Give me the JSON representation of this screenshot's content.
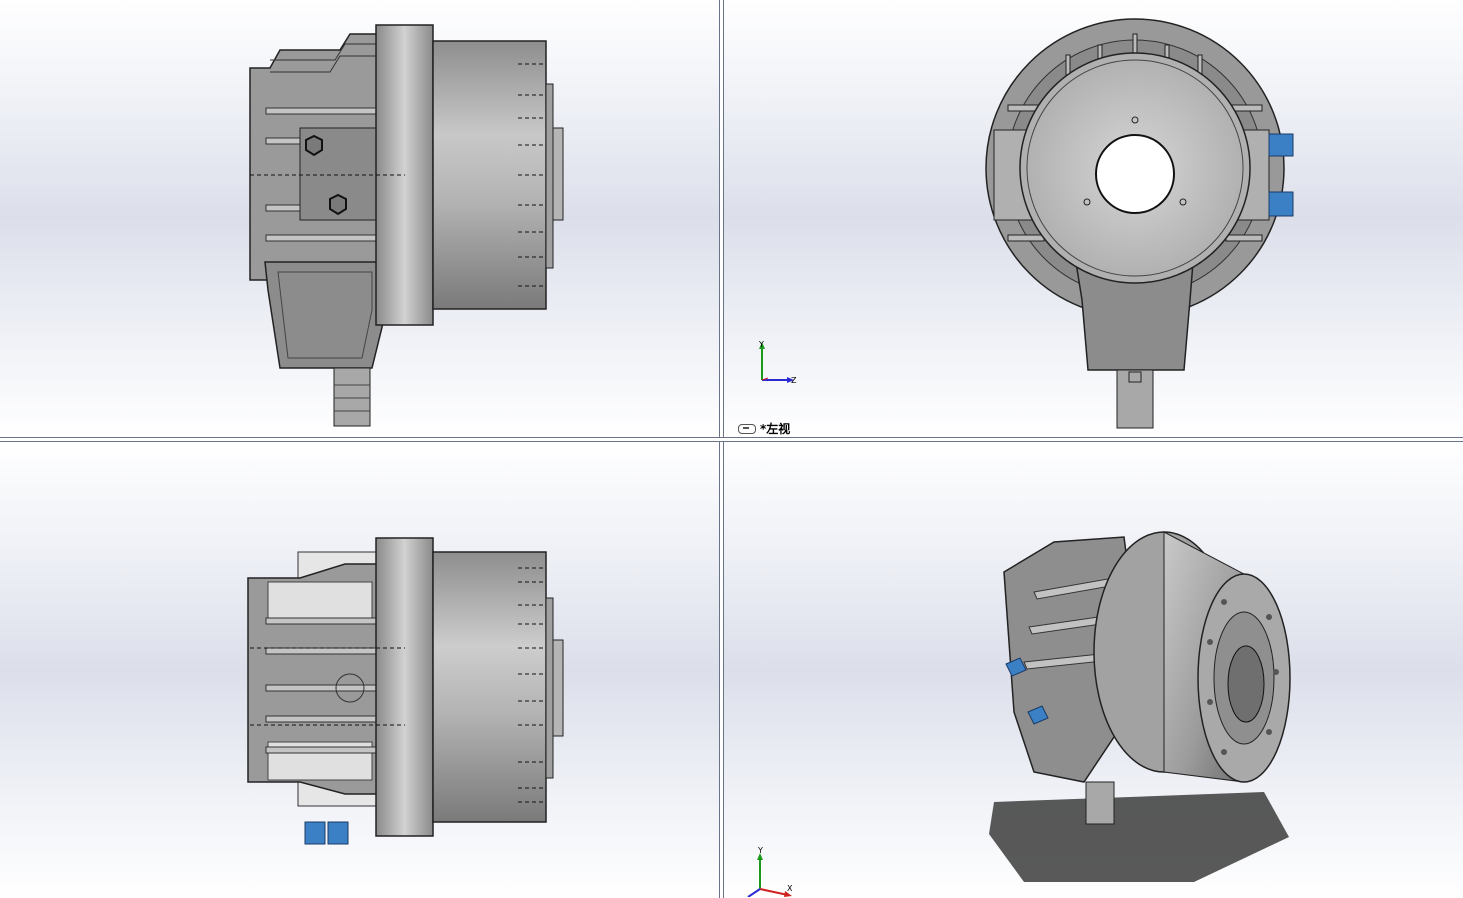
{
  "viewports": {
    "top_left": {
      "view": "front"
    },
    "top_right": {
      "view": "left",
      "label": "*左视"
    },
    "bottom_left": {
      "view": "top"
    },
    "bottom_right": {
      "view": "isometric"
    }
  },
  "triad": {
    "top_right": {
      "axes": [
        "Y",
        "Z"
      ]
    },
    "bottom_right": {
      "axes": [
        "Y",
        "X"
      ]
    }
  },
  "colors": {
    "body_gray": "#a3a3a3",
    "fitting_blue": "#3b7fc4",
    "separator": "#6b7388",
    "axis_y": "#1a9a1a",
    "axis_z": "#2a2ad0",
    "axis_x": "#d02020"
  }
}
